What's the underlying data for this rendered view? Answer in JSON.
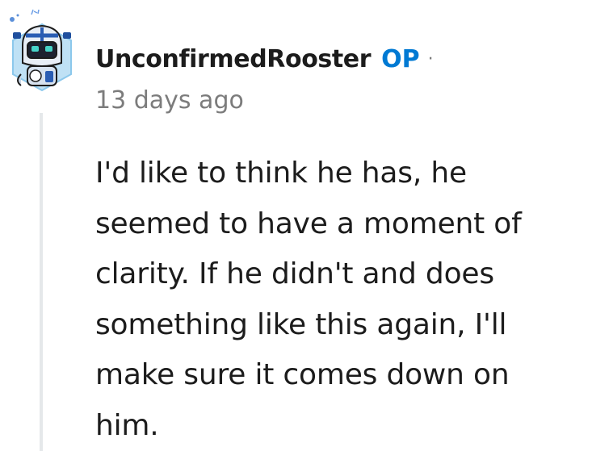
{
  "comment": {
    "author": "UnconfirmedRooster",
    "op_badge": "OP",
    "separator": "·",
    "timestamp": "13 days ago",
    "body_lines": [
      "I'd like to think he has, he",
      "seemed to have a moment of",
      "clarity. If he didn't and does",
      "something like this again, I'll",
      "make sure it comes down on",
      "him."
    ]
  },
  "colors": {
    "op_badge": "#0079d3",
    "text": "#1c1c1c",
    "meta": "#7c7c7c",
    "thread_line": "#e5e8ea"
  },
  "avatar": {
    "icon": "robot-avatar-icon"
  }
}
